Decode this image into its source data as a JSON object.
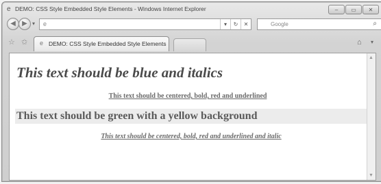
{
  "window": {
    "title": "DEMO: CSS Style Embedded Style Elements - Windows Internet Explorer",
    "buttons": {
      "minimize": "–",
      "maximize": "▭",
      "close": "✕"
    }
  },
  "navigation": {
    "back_icon": "◀",
    "forward_icon": "▶",
    "history_dropdown": "▾",
    "address_value": "",
    "refresh_icon": "↻",
    "stop_icon": "✕",
    "search_placeholder": "Google",
    "search_icon": "⌕"
  },
  "tabs": [
    {
      "label": "DEMO: CSS Style Embedded Style Elements"
    }
  ],
  "toolbar": {
    "favorites_icon": "☆",
    "add_favorite_icon": "✩",
    "home_icon": "⌂",
    "home_dropdown": "▾"
  },
  "page": {
    "heading1": "This text should be blue and italics",
    "paragraph1": "This text should be centered, bold, red and underlined",
    "heading2": "This text should be green with a yellow background",
    "paragraph2": "This text should be centered, bold, red and underlined and italic"
  }
}
